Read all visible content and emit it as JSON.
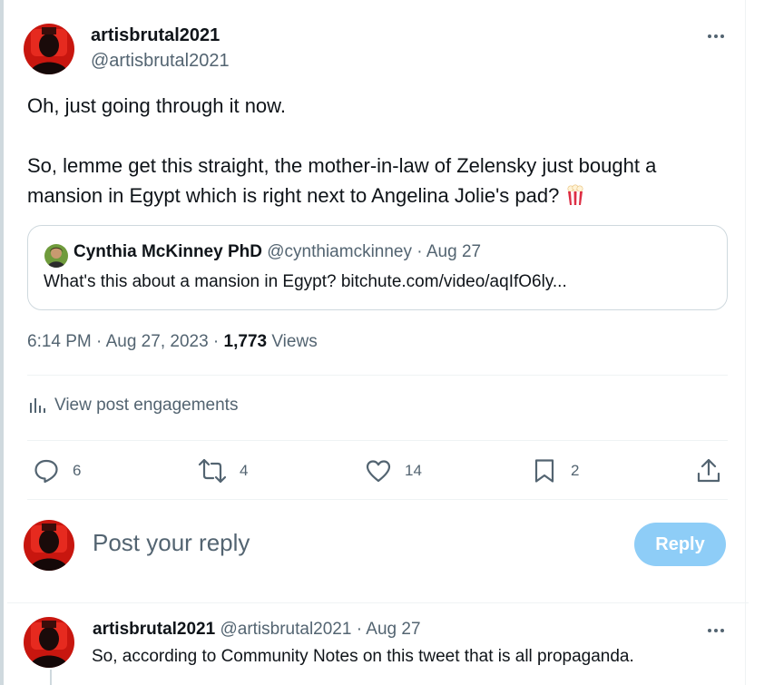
{
  "post": {
    "author_name": "artisbrutal2021",
    "author_handle": "@artisbrutal2021",
    "text": "Oh, just going through it now.\n\nSo, lemme get this straight, the mother-in-law of Zelensky just bought a mansion in Egypt which is right next to Angelina Jolie's pad?",
    "emoji_icon": "popcorn-icon"
  },
  "quote": {
    "author_name": "Cynthia McKinney PhD",
    "author_handle": "@cynthiamckinney",
    "dot": "·",
    "date": "Aug 27",
    "text": "What's this about a mansion in Egypt? bitchute.com/video/aqIfO6ly..."
  },
  "meta": {
    "time": "6:14 PM · Aug 27, 2023 · ",
    "views_count": "1,773",
    "views_label": " Views"
  },
  "engagements_label": "View post engagements",
  "actions": {
    "replies": "6",
    "reposts": "4",
    "likes": "14",
    "bookmarks": "2"
  },
  "composer": {
    "placeholder": "Post your reply",
    "reply_label": "Reply"
  },
  "reply": {
    "author_name": "artisbrutal2021",
    "author_handle": "@artisbrutal2021",
    "dot": "·",
    "date": "Aug 27",
    "text": "So, according to Community Notes on this tweet that is all propaganda."
  },
  "colors": {
    "text": "#0f1419",
    "secondary": "#536471",
    "border": "#cfd9de",
    "reply_button": "#8ecdf7"
  }
}
